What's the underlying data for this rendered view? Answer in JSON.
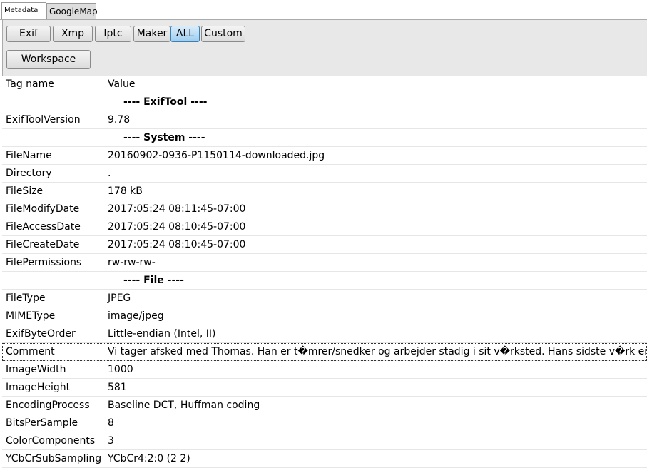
{
  "tabs": [
    "Metadata",
    "GoogleMap"
  ],
  "buttons": [
    "Exif",
    "Xmp",
    "Iptc",
    "Maker",
    "ALL",
    "Custom"
  ],
  "workspace": "Workspace",
  "columns": [
    "Tag name",
    "Value"
  ],
  "rows": [
    {
      "tag": "",
      "value": "---- ExifTool ----",
      "section": true
    },
    {
      "tag": "ExifToolVersion",
      "value": "9.78"
    },
    {
      "tag": "",
      "value": "---- System ----",
      "section": true
    },
    {
      "tag": "FileName",
      "value": "20160902-0936-P1150114-downloaded.jpg"
    },
    {
      "tag": "Directory",
      "value": "."
    },
    {
      "tag": "FileSize",
      "value": "178 kB"
    },
    {
      "tag": "FileModifyDate",
      "value": "2017:05:24 08:11:45-07:00"
    },
    {
      "tag": "FileAccessDate",
      "value": "2017:05:24 08:10:45-07:00"
    },
    {
      "tag": "FileCreateDate",
      "value": "2017:05:24 08:10:45-07:00"
    },
    {
      "tag": "FilePermissions",
      "value": "rw-rw-rw-"
    },
    {
      "tag": "",
      "value": "---- File ----",
      "section": true
    },
    {
      "tag": "FileType",
      "value": "JPEG"
    },
    {
      "tag": "MIMEType",
      "value": "image/jpeg"
    },
    {
      "tag": "ExifByteOrder",
      "value": "Little-endian (Intel, II)"
    },
    {
      "tag": "Comment",
      "value": "Vi tager afsked med Thomas. Han er t�mrer/snedker og arbejder stadig i sit v�rksted. Hans sidste v�rk er denne",
      "focus": true
    },
    {
      "tag": "ImageWidth",
      "value": "1000"
    },
    {
      "tag": "ImageHeight",
      "value": "581"
    },
    {
      "tag": "EncodingProcess",
      "value": "Baseline DCT, Huffman coding"
    },
    {
      "tag": "BitsPerSample",
      "value": "8"
    },
    {
      "tag": "ColorComponents",
      "value": "3"
    },
    {
      "tag": "YCbCrSubSampling",
      "value": "YCbCr4:2:0 (2 2)"
    }
  ]
}
